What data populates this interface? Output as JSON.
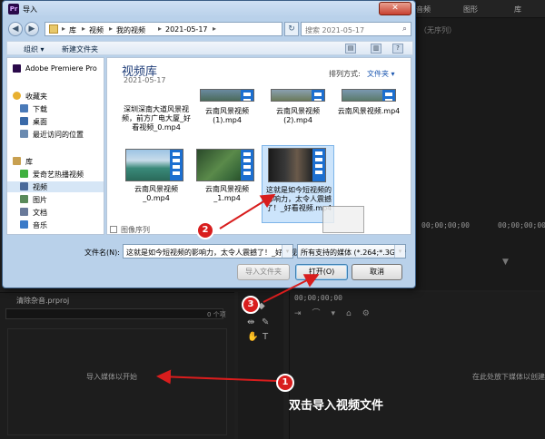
{
  "premiere": {
    "tabs": [
      "音频",
      "图形",
      "库"
    ],
    "program_none": "（无序列）",
    "timecode_left": "00;00;00;00",
    "timecode_right": "00;00;00;00",
    "project_name": "清除杂音.prproj",
    "item_count": "0 个项",
    "import_hint": "导入媒体以开始",
    "timeline_timecode": "00;00;00;00",
    "timeline_hint": "在此处放下媒体以创建"
  },
  "dialog": {
    "title": "导入",
    "close": "✕",
    "breadcrumbs": [
      "库",
      "视频",
      "我的视频",
      "2021-05-17"
    ],
    "search_placeholder": "搜索 2021-05-17",
    "toolbar": {
      "organize": "组织 ▾",
      "new_folder": "新建文件夹"
    },
    "nav": [
      {
        "label": "Adobe Premiere Pro",
        "color": "#2a0a4a"
      },
      {
        "label": "收藏夹",
        "color": "#e8b030"
      },
      {
        "label": "下载",
        "color": "#4a7ab8"
      },
      {
        "label": "桌面",
        "color": "#3a6aa8"
      },
      {
        "label": "最近访问的位置",
        "color": "#6a8ab0"
      },
      {
        "label": "库",
        "color": "#c8a050"
      },
      {
        "label": "爱奇艺热播视频",
        "color": "#40b040"
      },
      {
        "label": "视频",
        "color": "#4a6a9a"
      },
      {
        "label": "图片",
        "color": "#5a8a5a"
      },
      {
        "label": "文档",
        "color": "#6a7a9a"
      },
      {
        "label": "音乐",
        "color": "#3a7ac8"
      }
    ],
    "library_title": "视频库",
    "library_date": "2021-05-17",
    "sort_label": "排列方式:",
    "sort_value": "文件夹 ▾",
    "files_row1": [
      "深圳深南大道风景视频，前方广电大厦_好看视频_0.mp4",
      "云南风景视频(1).mp4",
      "云南风景视频(2).mp4",
      "云南风景视频.mp4"
    ],
    "files_row2": [
      "云南风景视频_0.mp4",
      "云南风景视频_1.mp4",
      "这就是如今短视频的影响力，太令人震撼了！_好看视频.mp4"
    ],
    "image_sequence": "图像序列",
    "filename_label": "文件名(N):",
    "filename_value": "这就是如今短视频的影响力，太令人震撼了！_好看视",
    "filetype_value": "所有支持的媒体 (*.264;*.3G2;*",
    "btn_import_folder": "导入文件夹",
    "btn_open": "打开(O)",
    "btn_cancel": "取消"
  },
  "annotations": {
    "badge1": "1",
    "badge2": "2",
    "badge3": "3",
    "caption": "双击导入视频文件"
  },
  "colors": {
    "annotation_red": "#d81d1d",
    "library_title": "#1e3c78",
    "film_strip": "#1c6fd0"
  }
}
